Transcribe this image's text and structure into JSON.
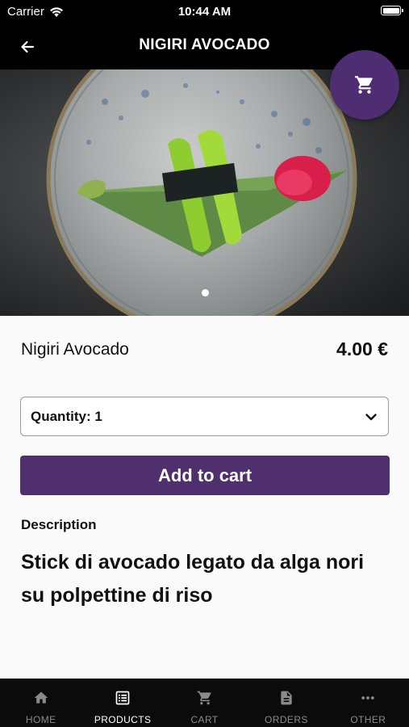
{
  "status_bar": {
    "carrier": "Carrier",
    "time": "10:44 AM"
  },
  "nav": {
    "title": "NIGIRI AVOCADO",
    "back_icon": "arrow-left-icon"
  },
  "cart_fab": {
    "icon": "cart-icon"
  },
  "gallery": {
    "page_count": 1,
    "current_page": 1
  },
  "product": {
    "name": "Nigiri Avocado",
    "price": "4.00 €",
    "quantity_label": "Quantity: 1",
    "add_to_cart_label": "Add to cart",
    "description_heading": "Description",
    "description": "Stick di avocado legato da alga nori su polpettine di riso"
  },
  "tabs": [
    {
      "label": "HOME",
      "icon": "home-icon",
      "active": false
    },
    {
      "label": "PRODUCTS",
      "icon": "list-icon",
      "active": true
    },
    {
      "label": "CART",
      "icon": "cart-icon",
      "active": false
    },
    {
      "label": "ORDERS",
      "icon": "document-icon",
      "active": false
    },
    {
      "label": "OTHER",
      "icon": "more-icon",
      "active": false
    }
  ],
  "colors": {
    "accent": "#4f2f6e",
    "fab": "#4e2d73",
    "tab_active": "#ffffff",
    "tab_inactive": "#8a8a8a",
    "bars": "#000000"
  }
}
